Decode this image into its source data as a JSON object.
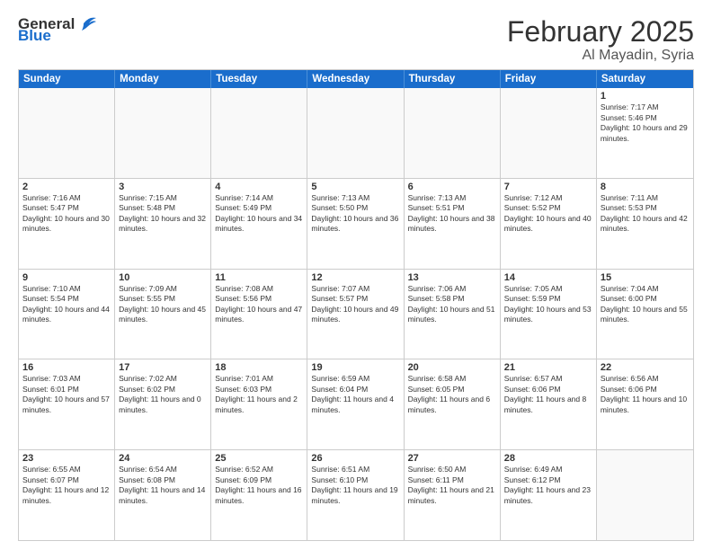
{
  "header": {
    "logo_general": "General",
    "logo_blue": "Blue",
    "title": "February 2025",
    "subtitle": "Al Mayadin, Syria"
  },
  "weekdays": [
    "Sunday",
    "Monday",
    "Tuesday",
    "Wednesday",
    "Thursday",
    "Friday",
    "Saturday"
  ],
  "weeks": [
    [
      {
        "day": "",
        "info": ""
      },
      {
        "day": "",
        "info": ""
      },
      {
        "day": "",
        "info": ""
      },
      {
        "day": "",
        "info": ""
      },
      {
        "day": "",
        "info": ""
      },
      {
        "day": "",
        "info": ""
      },
      {
        "day": "1",
        "info": "Sunrise: 7:17 AM\nSunset: 5:46 PM\nDaylight: 10 hours and 29 minutes."
      }
    ],
    [
      {
        "day": "2",
        "info": "Sunrise: 7:16 AM\nSunset: 5:47 PM\nDaylight: 10 hours and 30 minutes."
      },
      {
        "day": "3",
        "info": "Sunrise: 7:15 AM\nSunset: 5:48 PM\nDaylight: 10 hours and 32 minutes."
      },
      {
        "day": "4",
        "info": "Sunrise: 7:14 AM\nSunset: 5:49 PM\nDaylight: 10 hours and 34 minutes."
      },
      {
        "day": "5",
        "info": "Sunrise: 7:13 AM\nSunset: 5:50 PM\nDaylight: 10 hours and 36 minutes."
      },
      {
        "day": "6",
        "info": "Sunrise: 7:13 AM\nSunset: 5:51 PM\nDaylight: 10 hours and 38 minutes."
      },
      {
        "day": "7",
        "info": "Sunrise: 7:12 AM\nSunset: 5:52 PM\nDaylight: 10 hours and 40 minutes."
      },
      {
        "day": "8",
        "info": "Sunrise: 7:11 AM\nSunset: 5:53 PM\nDaylight: 10 hours and 42 minutes."
      }
    ],
    [
      {
        "day": "9",
        "info": "Sunrise: 7:10 AM\nSunset: 5:54 PM\nDaylight: 10 hours and 44 minutes."
      },
      {
        "day": "10",
        "info": "Sunrise: 7:09 AM\nSunset: 5:55 PM\nDaylight: 10 hours and 45 minutes."
      },
      {
        "day": "11",
        "info": "Sunrise: 7:08 AM\nSunset: 5:56 PM\nDaylight: 10 hours and 47 minutes."
      },
      {
        "day": "12",
        "info": "Sunrise: 7:07 AM\nSunset: 5:57 PM\nDaylight: 10 hours and 49 minutes."
      },
      {
        "day": "13",
        "info": "Sunrise: 7:06 AM\nSunset: 5:58 PM\nDaylight: 10 hours and 51 minutes."
      },
      {
        "day": "14",
        "info": "Sunrise: 7:05 AM\nSunset: 5:59 PM\nDaylight: 10 hours and 53 minutes."
      },
      {
        "day": "15",
        "info": "Sunrise: 7:04 AM\nSunset: 6:00 PM\nDaylight: 10 hours and 55 minutes."
      }
    ],
    [
      {
        "day": "16",
        "info": "Sunrise: 7:03 AM\nSunset: 6:01 PM\nDaylight: 10 hours and 57 minutes."
      },
      {
        "day": "17",
        "info": "Sunrise: 7:02 AM\nSunset: 6:02 PM\nDaylight: 11 hours and 0 minutes."
      },
      {
        "day": "18",
        "info": "Sunrise: 7:01 AM\nSunset: 6:03 PM\nDaylight: 11 hours and 2 minutes."
      },
      {
        "day": "19",
        "info": "Sunrise: 6:59 AM\nSunset: 6:04 PM\nDaylight: 11 hours and 4 minutes."
      },
      {
        "day": "20",
        "info": "Sunrise: 6:58 AM\nSunset: 6:05 PM\nDaylight: 11 hours and 6 minutes."
      },
      {
        "day": "21",
        "info": "Sunrise: 6:57 AM\nSunset: 6:06 PM\nDaylight: 11 hours and 8 minutes."
      },
      {
        "day": "22",
        "info": "Sunrise: 6:56 AM\nSunset: 6:06 PM\nDaylight: 11 hours and 10 minutes."
      }
    ],
    [
      {
        "day": "23",
        "info": "Sunrise: 6:55 AM\nSunset: 6:07 PM\nDaylight: 11 hours and 12 minutes."
      },
      {
        "day": "24",
        "info": "Sunrise: 6:54 AM\nSunset: 6:08 PM\nDaylight: 11 hours and 14 minutes."
      },
      {
        "day": "25",
        "info": "Sunrise: 6:52 AM\nSunset: 6:09 PM\nDaylight: 11 hours and 16 minutes."
      },
      {
        "day": "26",
        "info": "Sunrise: 6:51 AM\nSunset: 6:10 PM\nDaylight: 11 hours and 19 minutes."
      },
      {
        "day": "27",
        "info": "Sunrise: 6:50 AM\nSunset: 6:11 PM\nDaylight: 11 hours and 21 minutes."
      },
      {
        "day": "28",
        "info": "Sunrise: 6:49 AM\nSunset: 6:12 PM\nDaylight: 11 hours and 23 minutes."
      },
      {
        "day": "",
        "info": ""
      }
    ]
  ]
}
